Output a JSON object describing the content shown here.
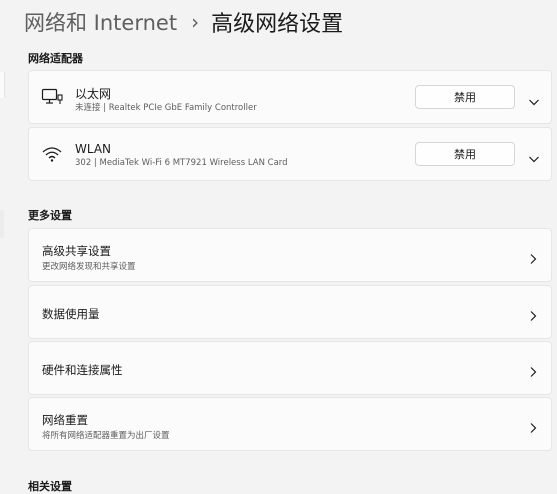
{
  "breadcrumb": {
    "parent": "网络和 Internet",
    "separator": "›",
    "current": "高级网络设置"
  },
  "sections": {
    "adapters_label": "网络适配器",
    "more_label": "更多设置",
    "related_label": "相关设置"
  },
  "adapters": [
    {
      "icon": "ethernet-icon",
      "name": "以太网",
      "detail": "未连接 | Realtek PCIe GbE Family Controller",
      "button_label": "禁用"
    },
    {
      "icon": "wifi-icon",
      "name": "WLAN",
      "detail": "302 | MediaTek Wi-Fi 6 MT7921 Wireless LAN Card",
      "button_label": "禁用"
    }
  ],
  "more_settings": [
    {
      "title": "高级共享设置",
      "subtitle": "更改网络发现和共享设置"
    },
    {
      "title": "数据使用量",
      "subtitle": ""
    },
    {
      "title": "硬件和连接属性",
      "subtitle": ""
    },
    {
      "title": "网络重置",
      "subtitle": "将所有网络适配器重置为出厂设置"
    }
  ],
  "colors": {
    "page_bg": "#f3f3f3",
    "card_bg": "#fbfbfb",
    "text": "#1b1b1b",
    "secondary_text": "#5d5d5d"
  }
}
